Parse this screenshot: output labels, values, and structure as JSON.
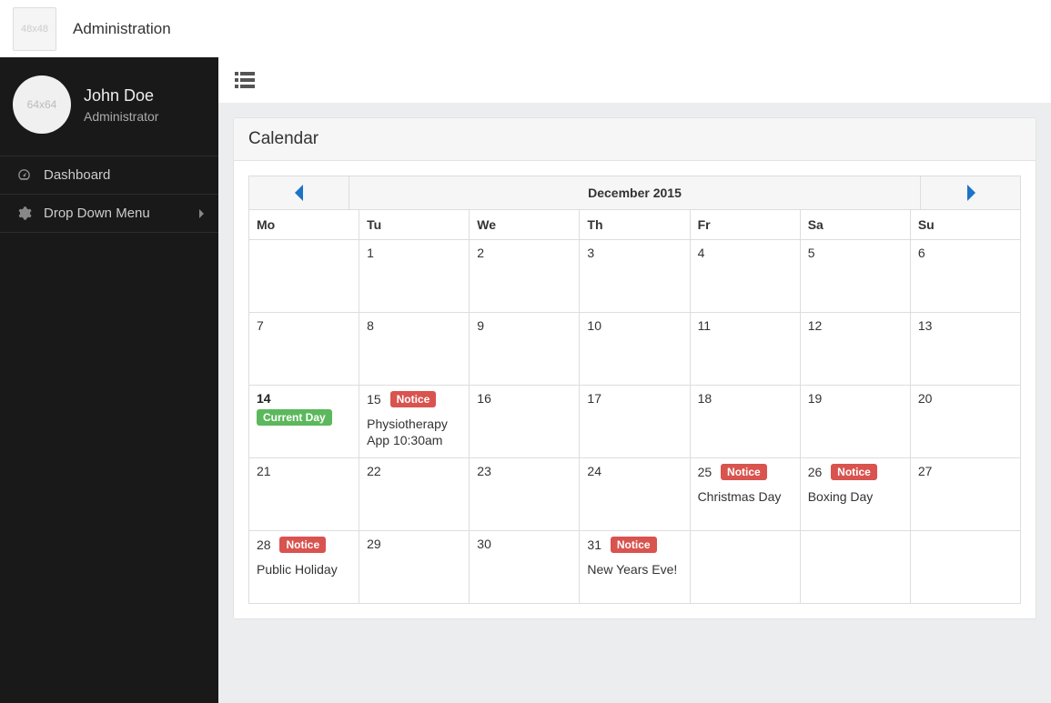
{
  "header": {
    "logo_placeholder": "48x48",
    "app_title": "Administration"
  },
  "user": {
    "avatar_placeholder": "64x64",
    "name": "John Doe",
    "role": "Administrator"
  },
  "nav": {
    "dashboard": "Dashboard",
    "dropdown": "Drop Down Menu"
  },
  "panel": {
    "title": "Calendar"
  },
  "calendar": {
    "title": "December 2015",
    "dow": {
      "mo": "Mo",
      "tu": "Tu",
      "we": "We",
      "th": "Th",
      "fr": "Fr",
      "sa": "Sa",
      "su": "Su"
    },
    "badges": {
      "current_day": "Current Day",
      "notice": "Notice"
    },
    "days": {
      "d1": "1",
      "d2": "2",
      "d3": "3",
      "d4": "4",
      "d5": "5",
      "d6": "6",
      "d7": "7",
      "d8": "8",
      "d9": "9",
      "d10": "10",
      "d11": "11",
      "d12": "12",
      "d13": "13",
      "d14": "14",
      "d15": "15",
      "d16": "16",
      "d17": "17",
      "d18": "18",
      "d19": "19",
      "d20": "20",
      "d21": "21",
      "d22": "22",
      "d23": "23",
      "d24": "24",
      "d25": "25",
      "d26": "26",
      "d27": "27",
      "d28": "28",
      "d29": "29",
      "d30": "30",
      "d31": "31"
    },
    "events": {
      "d15": "Physiotherapy App 10:30am",
      "d25": "Christmas Day",
      "d26": "Boxing Day",
      "d28": "Public Holiday",
      "d31": "New Years Eve!"
    }
  }
}
